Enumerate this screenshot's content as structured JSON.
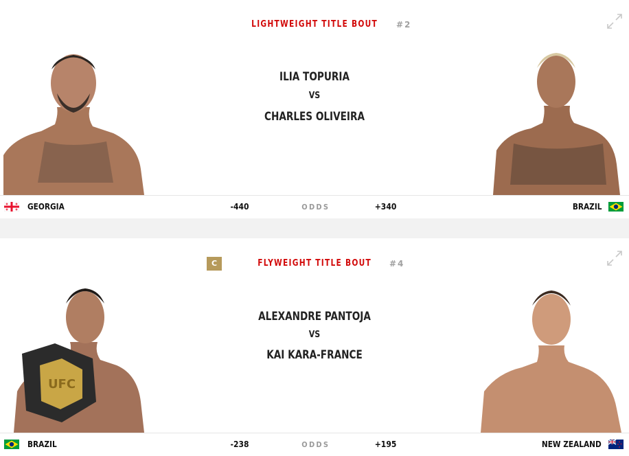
{
  "bouts": [
    {
      "weight_class": "LIGHTWEIGHT TITLE BOUT",
      "rank": "#2",
      "badge": "",
      "red_name": "ILIA TOPURIA",
      "vs": "VS",
      "blue_name": "CHARLES OLIVEIRA",
      "red_country": "GEORGIA",
      "blue_country": "BRAZIL",
      "red_odds": "-440",
      "blue_odds": "+340",
      "odds_label": "ODDS",
      "red_flag_icon": "georgia-flag-icon",
      "blue_flag_icon": "brazil-flag-icon"
    },
    {
      "weight_class": "FLYWEIGHT TITLE BOUT",
      "rank": "#4",
      "badge": "C",
      "red_name": "ALEXANDRE PANTOJA",
      "vs": "VS",
      "blue_name": "KAI KARA-FRANCE",
      "red_country": "BRAZIL",
      "blue_country": "NEW ZEALAND",
      "red_odds": "-238",
      "blue_odds": "+195",
      "odds_label": "ODDS",
      "red_flag_icon": "brazil-flag-icon",
      "blue_flag_icon": "new-zealand-flag-icon"
    }
  ],
  "colors": {
    "accent_red": "#d20a0a",
    "champion_gold": "#b69a5b",
    "muted_grey": "#9a9a9a"
  },
  "icons": {
    "expand": "expand-icon"
  }
}
